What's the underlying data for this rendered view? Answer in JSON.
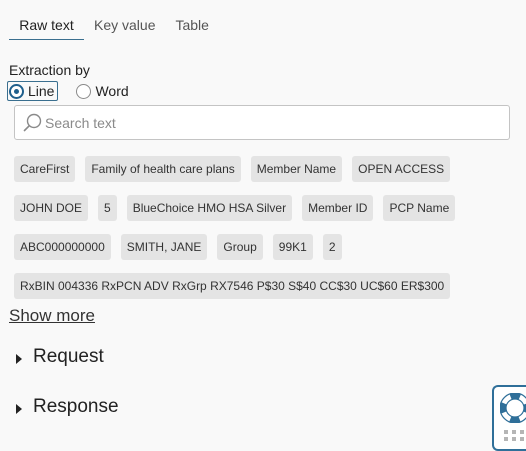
{
  "tabs": [
    "Raw text",
    "Key value",
    "Table"
  ],
  "extraction": {
    "label": "Extraction by",
    "options": [
      "Line",
      "Word"
    ],
    "selected": "Line"
  },
  "search": {
    "placeholder": "Search text",
    "value": ""
  },
  "chips": [
    [
      "CareFirst",
      "Family of health care plans",
      "Member Name",
      "OPEN ACCESS"
    ],
    [
      "JOHN DOE",
      "5",
      "BlueChoice HMO HSA Silver",
      "Member ID",
      "PCP Name"
    ],
    [
      "ABC000000000",
      "SMITH, JANE",
      "Group",
      "99K1",
      "2"
    ],
    [
      "RxBIN 004336 RxPCN ADV RxGrp RX7546 P$30 S$40 CC$30 UC$60 ER$300"
    ]
  ],
  "show_more": "Show more",
  "sections": {
    "request": "Request",
    "response": "Response"
  },
  "colors": {
    "accent": "#1f5f8c",
    "chip_bg": "#e4e4e4",
    "page_bg": "#f9f9f9"
  }
}
